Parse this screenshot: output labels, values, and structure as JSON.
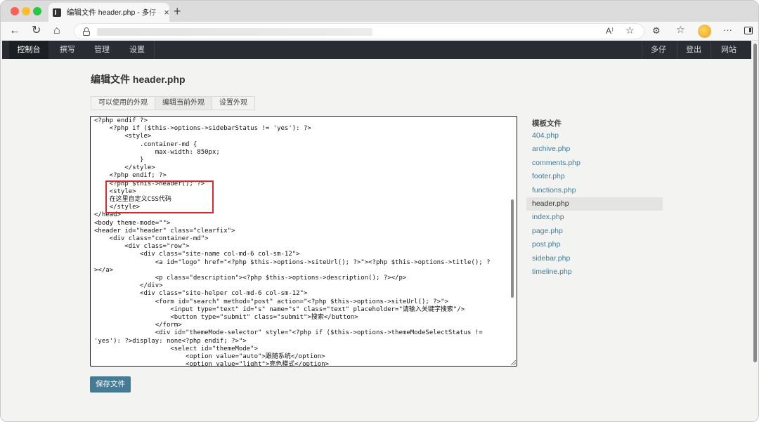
{
  "browser": {
    "tab_title": "编辑文件 header.php - 多仔 - Powered by Typecho",
    "tab_close": "×",
    "new_tab": "+",
    "back_icon": "←",
    "reload_icon": "↻",
    "home_icon": "⌂",
    "read_aloud": "A⁾",
    "favorite_icon": "☆",
    "extensions_icon": "⚙",
    "favorites_icon": "☆",
    "more_icon": "···"
  },
  "admin_nav": {
    "left": [
      "控制台",
      "撰写",
      "管理",
      "设置"
    ],
    "right": [
      "多仔",
      "登出",
      "网站"
    ]
  },
  "page": {
    "title": "编辑文件 header.php",
    "subtabs": [
      "可以使用的外观",
      "编辑当前外观",
      "设置外观"
    ],
    "save_button": "保存文件"
  },
  "editor": {
    "lines": [
      "<?php endif ?>",
      "    <?php if ($this->options->sidebarStatus != 'yes'): ?>",
      "        <style>",
      "            .container-md {",
      "                max-width: 850px;",
      "            }",
      "        </style>",
      "    <?php endif; ?>",
      "    <?php $this->header(); ?>",
      "    <style>",
      "    在这里自定义CSS代码",
      "    </style>",
      "</head>",
      "<body theme-mode=\"\">",
      "<header id=\"header\" class=\"clearfix\">",
      "    <div class=\"container-md\">",
      "        <div class=\"row\">",
      "            <div class=\"site-name col-md-6 col-sm-12\">",
      "                <a id=\"logo\" href=\"<?php $this->options->siteUrl(); ?>\"><?php $this->options->title(); ?",
      "></a>",
      "                <p class=\"description\"><?php $this->options->description(); ?></p>",
      "            </div>",
      "            <div class=\"site-helper col-md-6 col-sm-12\">",
      "                <form id=\"search\" method=\"post\" action=\"<?php $this->options->siteUrl(); ?>\">",
      "                    <input type=\"text\" id=\"s\" name=\"s\" class=\"text\" placeholder=\"请输入关键字搜索\"/>",
      "                    <button type=\"submit\" class=\"submit\">搜索</button>",
      "                </form>",
      "                <div id=\"themeMode-selector\" style=\"<?php if ($this->options->themeModeSelectStatus !=",
      "'yes'): ?>display: none<?php endif; ?>\">",
      "                    <select id=\"themeMode\">",
      "                        <option value=\"auto\">跟随系统</option>",
      "                        <option value=\"light\">亮色模式</option>"
    ]
  },
  "files": {
    "heading": "模板文件",
    "items": [
      "404.php",
      "archive.php",
      "comments.php",
      "footer.php",
      "functions.php",
      "header.php",
      "index.php",
      "page.php",
      "post.php",
      "sidebar.php",
      "timeline.php"
    ],
    "current_index": 5
  },
  "colors": {
    "nav_bg": "#292d33",
    "link": "#467b96",
    "highlight_box": "#e0282c",
    "save_button": "#467b96"
  }
}
